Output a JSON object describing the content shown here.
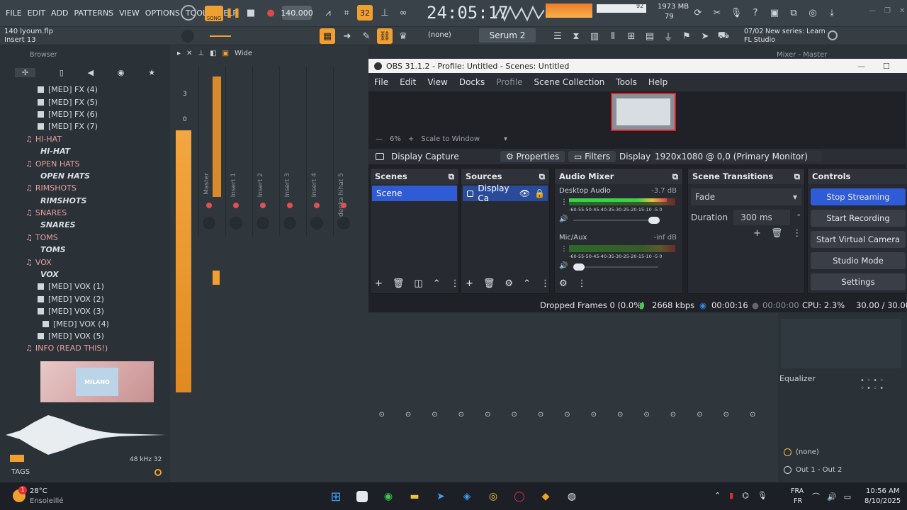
{
  "fl": {
    "menu": [
      "FILE",
      "EDIT",
      "ADD",
      "PATTERNS",
      "VIEW",
      "OPTIONS",
      "TOOLS",
      "HELP"
    ],
    "song_label": "SONG",
    "pat_label": "PAT",
    "tempo": "140.000",
    "time": "24:05:17",
    "cpu_mem": "1973 MB",
    "cpu_num": "79",
    "cpu_pct": "92",
    "project": "140 lyoum.flp",
    "insert": "Insert 13",
    "pattern_none": "(none)",
    "plugin": "Serum 2",
    "news_date": "07/02",
    "news_text": "New series: Learn",
    "news_sub": "FL Studio",
    "mixer_title": "Mixer - Master",
    "browser_label": "Browser",
    "wide_label": "Wide",
    "browser_items": [
      {
        "t": "[MED] FX (4)",
        "k": "folder"
      },
      {
        "t": "[MED] FX (5)",
        "k": "folder"
      },
      {
        "t": "[MED] FX (6)",
        "k": "folder"
      },
      {
        "t": "[MED] FX (7)",
        "k": "folder"
      },
      {
        "t": "HI-HAT",
        "k": "cat"
      },
      {
        "t": "HI-HAT",
        "k": "bold"
      },
      {
        "t": "OPEN HATS",
        "k": "cat"
      },
      {
        "t": "OPEN HATS",
        "k": "bold"
      },
      {
        "t": "RIMSHOTS",
        "k": "cat"
      },
      {
        "t": "RIMSHOTS",
        "k": "bold"
      },
      {
        "t": "SNARES",
        "k": "cat"
      },
      {
        "t": "SNARES",
        "k": "bold"
      },
      {
        "t": "TOMS",
        "k": "cat"
      },
      {
        "t": "TOMS",
        "k": "bold"
      },
      {
        "t": "VOX",
        "k": "cat"
      },
      {
        "t": "VOX",
        "k": "bold"
      },
      {
        "t": "[MED] VOX (1)",
        "k": "folder"
      },
      {
        "t": "[MED] VOX (2)",
        "k": "folder"
      },
      {
        "t": "[MED] VOX (3)",
        "k": "folder"
      },
      {
        "t": "[MED] VOX (4)",
        "k": "sub"
      },
      {
        "t": "[MED] VOX (5)",
        "k": "folder"
      },
      {
        "t": "INFO (READ THIS!)",
        "k": "cat"
      }
    ],
    "thumb_text": "MILANO",
    "sample_info": "48 kHz 32",
    "tags_label": "TAGS",
    "meter_3": "3",
    "meter_0": "0",
    "mixer_tracks": [
      "Master",
      "Insert 1",
      "Insert 2",
      "Insert 3",
      "Insert 4",
      "Madenka hihat 5"
    ],
    "equalizer_label": "Equalizer",
    "route_none": "(none)",
    "route_out": "Out 1 - Out 2"
  },
  "obs": {
    "title": "OBS 31.1.2 - Profile: Untitled - Scenes: Untitled",
    "menu": [
      "File",
      "Edit",
      "View",
      "Docks",
      "Profile",
      "Scene Collection",
      "Tools",
      "Help"
    ],
    "zoom": "6%",
    "scale": "Scale to Window",
    "source_bar": {
      "name": "Display Capture",
      "properties": "Properties",
      "filters": "Filters",
      "display_label": "Display",
      "display_value": "1920x1080 @ 0,0 (Primary Monitor)"
    },
    "scenes": {
      "title": "Scenes",
      "items": [
        "Scene"
      ]
    },
    "sources": {
      "title": "Sources",
      "items": [
        "Display Ca"
      ]
    },
    "audio": {
      "title": "Audio Mixer",
      "channels": [
        {
          "name": "Desktop Audio",
          "db": "-3.7 dB",
          "level": 0.92
        },
        {
          "name": "Mic/Aux",
          "db": "-inf dB",
          "level": 0.0
        }
      ],
      "scale": "-60-55-50-45-40-35-30-25-20-15-10 -5  0"
    },
    "transitions": {
      "title": "Scene Transitions",
      "type": "Fade",
      "duration_label": "Duration",
      "duration": "300 ms"
    },
    "controls": {
      "title": "Controls",
      "buttons": [
        "Stop Streaming",
        "Start Recording",
        "Start Virtual Camera",
        "Studio Mode",
        "Settings"
      ]
    },
    "status": {
      "dropped": "Dropped Frames 0 (0.0%)",
      "bitrate": "2668 kbps",
      "stream_time": "00:00:16",
      "rec_time": "00:00:00",
      "cpu": "CPU: 2.3%",
      "fps": "30.00 / 30.00 FPS"
    }
  },
  "taskbar": {
    "weather_temp": "28°C",
    "weather_text": "Ensoleillé",
    "weather_badge": "1",
    "lang1": "FRA",
    "lang2": "FR",
    "time": "10:56 AM",
    "date": "8/10/2025"
  },
  "colors": {
    "accent": "#2f5bd6",
    "fl_orange": "#f0a030",
    "obs_bg": "#1f2126"
  }
}
